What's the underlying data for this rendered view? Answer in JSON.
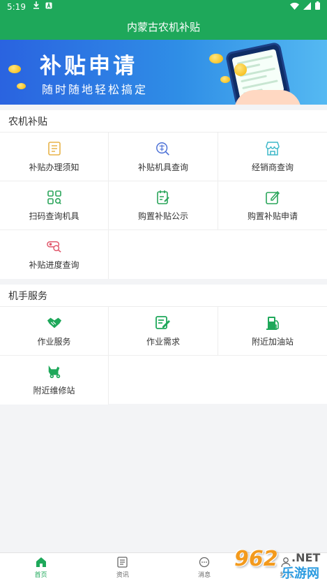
{
  "status_bar": {
    "time": "5:19",
    "icons": [
      "download-icon",
      "notification-a-icon",
      "wifi-icon",
      "signal-icon",
      "battery-icon"
    ]
  },
  "app_bar": {
    "title": "内蒙古农机补贴"
  },
  "banner": {
    "title": "补贴申请",
    "subtitle": "随时随地轻松搞定"
  },
  "sections": [
    {
      "title": "农机补贴",
      "items": [
        {
          "label": "补贴办理须知",
          "icon": "document-list-icon",
          "color": "#e8b44a"
        },
        {
          "label": "补贴机具查询",
          "icon": "subsidy-search-icon",
          "color": "#4a6fd6"
        },
        {
          "label": "经销商查询",
          "icon": "store-icon",
          "color": "#3fb8c9"
        },
        {
          "label": "扫码查询机具",
          "icon": "scan-grid-icon",
          "color": "#2aa55a"
        },
        {
          "label": "购置补贴公示",
          "icon": "notice-edit-icon",
          "color": "#2aa55a"
        },
        {
          "label": "购置补贴申请",
          "icon": "apply-edit-icon",
          "color": "#2aa55a"
        },
        {
          "label": "补贴进度查询",
          "icon": "progress-search-icon",
          "color": "#e0566a"
        }
      ]
    },
    {
      "title": "机手服务",
      "items": [
        {
          "label": "作业服务",
          "icon": "handshake-icon",
          "color": "#1ea85a"
        },
        {
          "label": "作业需求",
          "icon": "demand-edit-icon",
          "color": "#1ea85a"
        },
        {
          "label": "附近加油站",
          "icon": "fuel-pump-icon",
          "color": "#1ea85a"
        },
        {
          "label": "附近维修站",
          "icon": "repair-tractor-icon",
          "color": "#1ea85a"
        }
      ]
    }
  ],
  "tab_bar": {
    "tabs": [
      {
        "label": "首页",
        "icon": "home-icon",
        "active": true
      },
      {
        "label": "资讯",
        "icon": "news-icon",
        "active": false
      },
      {
        "label": "消息",
        "icon": "message-icon",
        "active": false
      },
      {
        "label": "我的",
        "icon": "profile-icon",
        "active": false
      }
    ]
  },
  "watermark": {
    "number": "962",
    "suffix": ".NET",
    "text": "乐游网"
  },
  "colors": {
    "primary": "#1ea85a",
    "background": "#f3f4f6"
  }
}
